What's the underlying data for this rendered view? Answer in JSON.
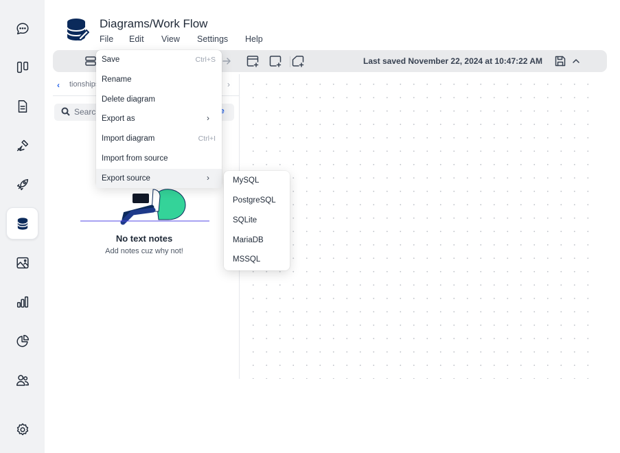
{
  "rail": {
    "items": [
      {
        "name": "chat-icon"
      },
      {
        "name": "columns-icon"
      },
      {
        "name": "document-icon"
      },
      {
        "name": "tools-icon"
      },
      {
        "name": "rocket-icon"
      },
      {
        "name": "database-icon",
        "active": true
      },
      {
        "name": "image-icon"
      },
      {
        "name": "bar-chart-icon"
      },
      {
        "name": "pie-chart-icon"
      },
      {
        "name": "users-icon"
      },
      {
        "name": "settings-icon"
      }
    ]
  },
  "header": {
    "title": "Diagrams/Work Flow",
    "menus": {
      "file": "File",
      "edit": "Edit",
      "view": "View",
      "settings": "Settings",
      "help": "Help"
    }
  },
  "toolbar": {
    "last_saved": "Last saved November 22, 2024 at 10:47:22 AM"
  },
  "side_panel": {
    "tab_label": "tionships",
    "search_placeholder": "Search",
    "create_label": "te",
    "empty_title": "No text notes",
    "empty_subtitle": "Add notes cuz why not!"
  },
  "file_menu": {
    "items": [
      {
        "label": "Save",
        "shortcut": "Ctrl+S"
      },
      {
        "label": "Rename",
        "shortcut": ""
      },
      {
        "label": "Delete diagram",
        "shortcut": ""
      },
      {
        "label": "Export as",
        "submenu": true
      },
      {
        "label": "Import diagram",
        "shortcut": "Ctrl+I"
      },
      {
        "label": "Import from source",
        "shortcut": ""
      },
      {
        "label": "Export source",
        "submenu": true,
        "hover": true
      }
    ]
  },
  "export_source_menu": {
    "items": [
      "MySQL",
      "PostgreSQL",
      "SQLite",
      "MariaDB",
      "MSSQL"
    ]
  },
  "colors": {
    "accent": "#2563eb",
    "logo": "#0b2a5b",
    "illustration_green": "#34d399"
  }
}
